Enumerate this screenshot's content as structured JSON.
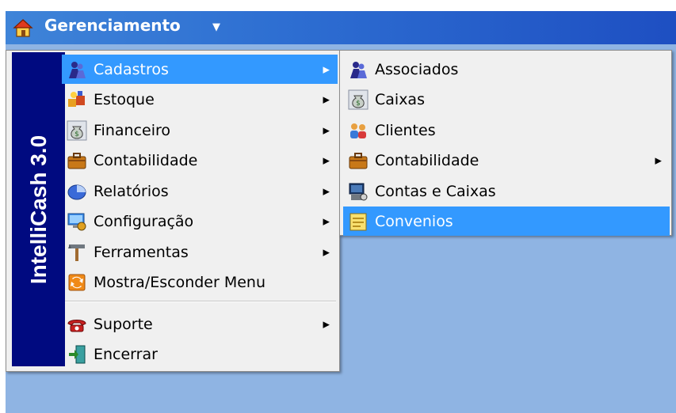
{
  "titlebar": {
    "title": "Gerenciamento"
  },
  "sidebar": {
    "label": "IntelliCash 3.0"
  },
  "main_menu": {
    "items": [
      {
        "label": "Cadastros",
        "icon": "people-icon",
        "submenu": true,
        "selected": true
      },
      {
        "label": "Estoque",
        "icon": "boxes-icon",
        "submenu": true
      },
      {
        "label": "Financeiro",
        "icon": "money-bag-icon",
        "submenu": true
      },
      {
        "label": "Contabilidade",
        "icon": "briefcase-icon",
        "submenu": true
      },
      {
        "label": "Relatórios",
        "icon": "pie-chart-icon",
        "submenu": true
      },
      {
        "label": "Configuração",
        "icon": "settings-computer-icon",
        "submenu": true
      },
      {
        "label": "Ferramentas",
        "icon": "tools-icon",
        "submenu": true
      },
      {
        "label": "Mostra/Esconder Menu",
        "icon": "toggle-menu-icon",
        "submenu": false
      },
      {
        "label": "Suporte",
        "icon": "telephone-icon",
        "submenu": true
      },
      {
        "label": "Encerrar",
        "icon": "exit-door-icon",
        "submenu": false
      }
    ]
  },
  "sub_menu": {
    "items": [
      {
        "label": "Associados",
        "icon": "people-icon",
        "submenu": false
      },
      {
        "label": "Caixas",
        "icon": "money-bag-icon",
        "submenu": false
      },
      {
        "label": "Clientes",
        "icon": "clients-icon",
        "submenu": false
      },
      {
        "label": "Contabilidade",
        "icon": "briefcase-icon",
        "submenu": true
      },
      {
        "label": "Contas e Caixas",
        "icon": "cash-register-icon",
        "submenu": false
      },
      {
        "label": "Convenios",
        "icon": "notepad-icon",
        "submenu": false,
        "selected": true
      }
    ]
  },
  "colors": {
    "selection": "#3399ff",
    "sidebar": "#000a80",
    "titlebar": "#2e6fd2",
    "desktop": "#8fb4e3"
  }
}
